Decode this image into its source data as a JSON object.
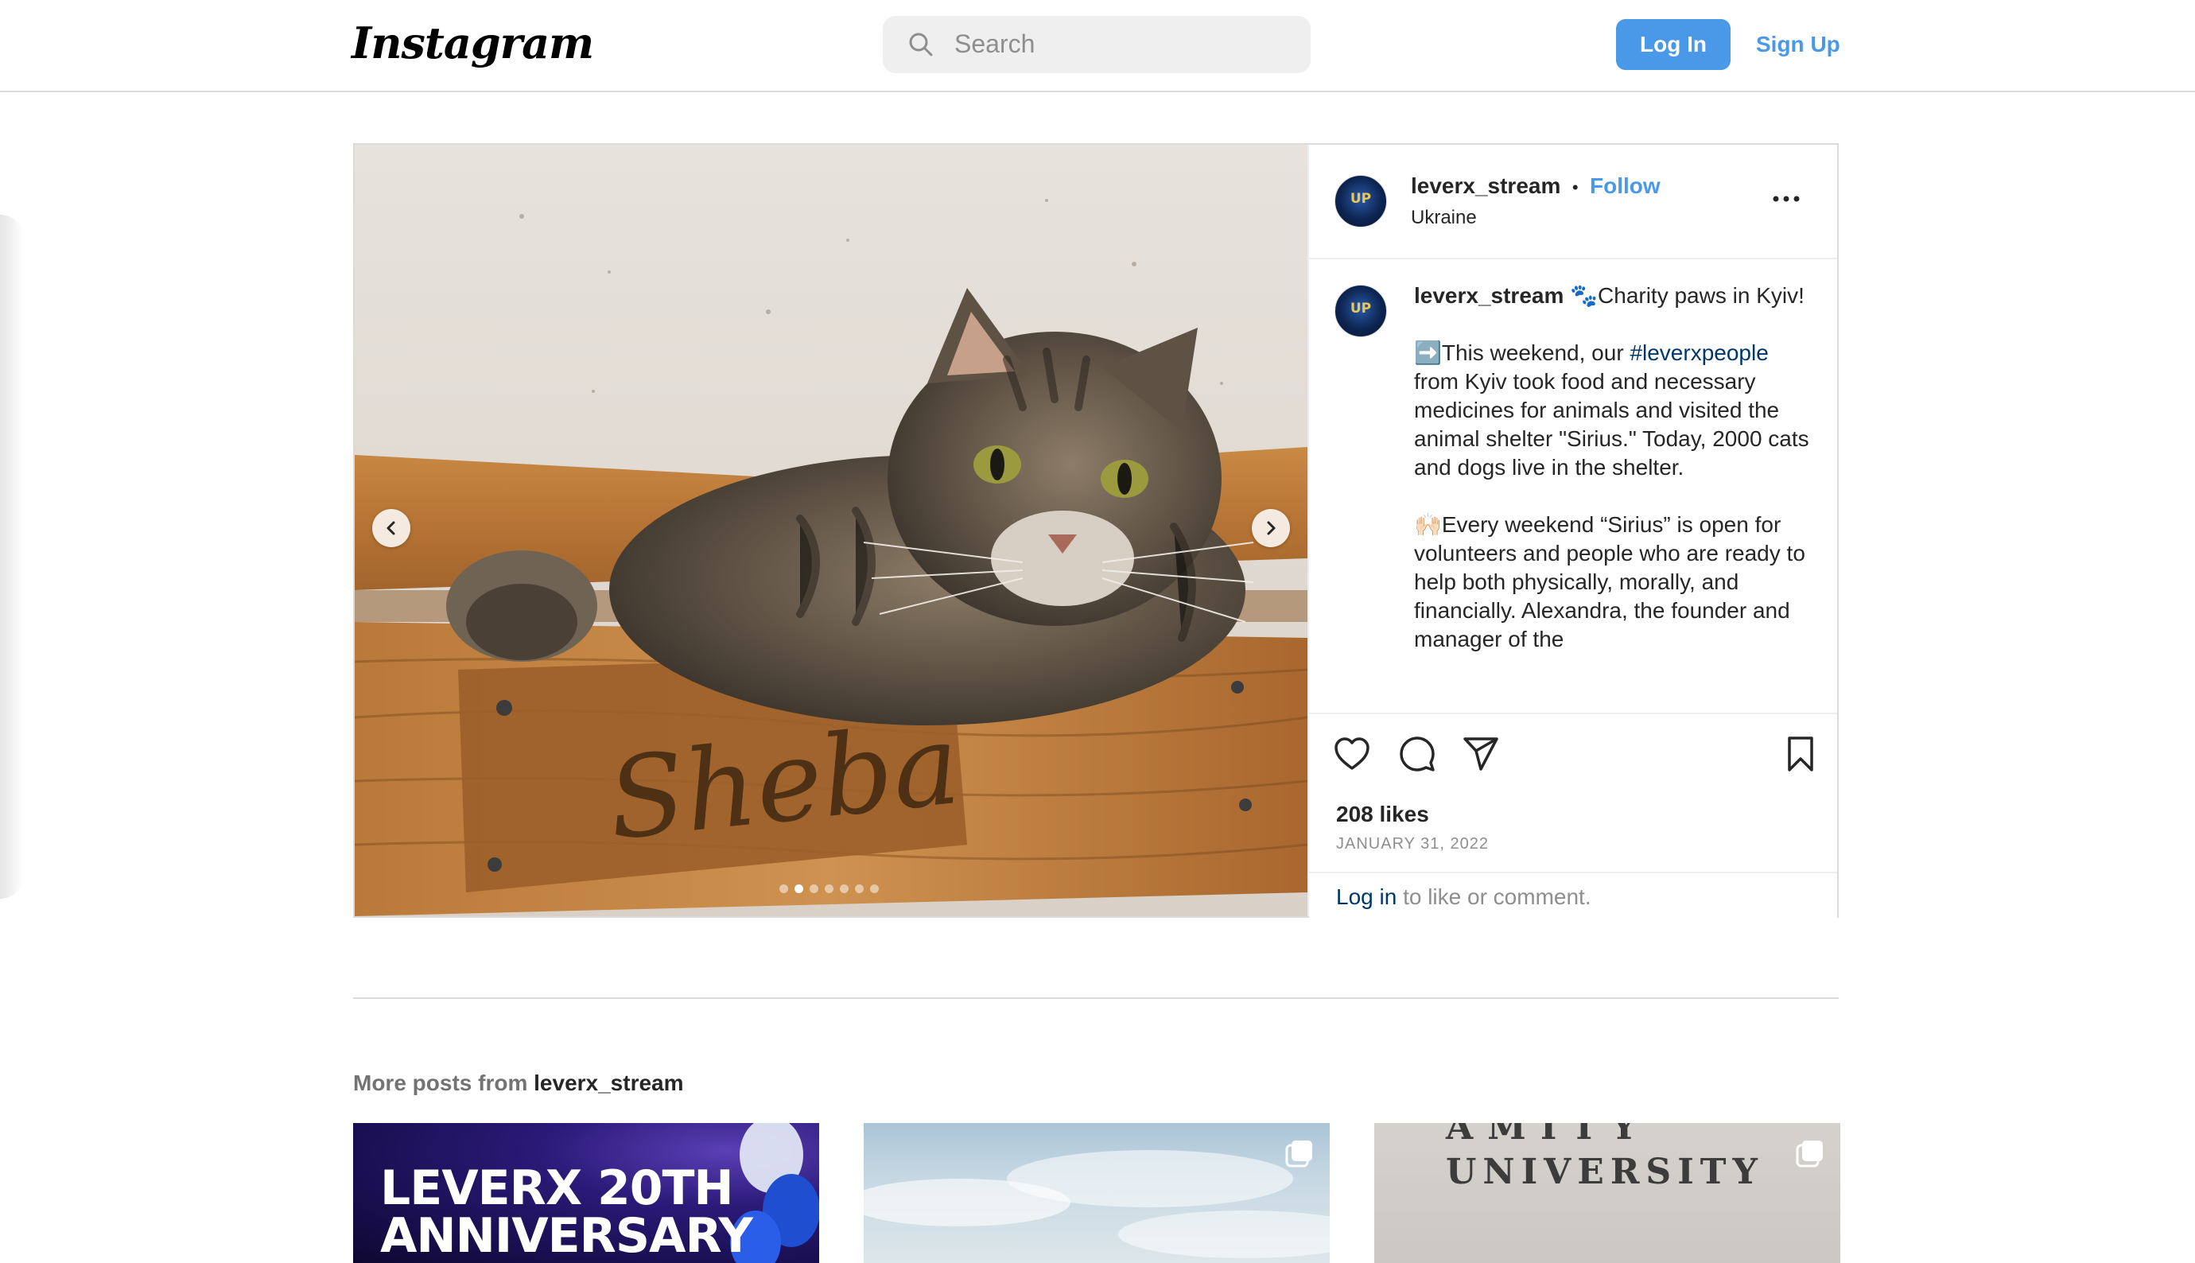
{
  "header": {
    "logo_text": "Instagram",
    "search_placeholder": "Search",
    "login_label": "Log In",
    "signup_label": "Sign Up"
  },
  "post": {
    "username": "leverx_stream",
    "separator": "•",
    "follow_label": "Follow",
    "location": "Ukraine",
    "avatar_text": "UP",
    "more_options_icon": "more-horizontal-icon",
    "caption": {
      "username": "leverx_stream",
      "line1": "🐾Charity paws in Kyiv!",
      "para2_prefix": "➡️This weekend, our ",
      "para2_hashtag": "#leverxpeople",
      "para2_suffix": " from Kyiv took food and necessary medicines for animals and visited the animal shelter \"Sirius.\" Today, 2000 cats and dogs live in the shelter.",
      "para3": "🙌🏻Every weekend “Sirius” is open for volunteers and people who are ready to help both physically, morally, and financially. Alexandra, the founder and manager of the"
    },
    "media": {
      "board_text": "Sheba",
      "carousel_total": 7,
      "carousel_active": 2
    },
    "likes": "208 likes",
    "date": "JANUARY 31, 2022",
    "login_link": "Log in",
    "login_suffix": " to like or comment.",
    "icons": [
      "heart-icon",
      "comment-icon",
      "share-icon",
      "bookmark-icon"
    ]
  },
  "more_posts": {
    "prefix": "More posts from ",
    "username": "leverx_stream",
    "thumbs": [
      {
        "line1": "LEVERX 20TH",
        "line2": "ANNIVERSARY"
      },
      {},
      {
        "top_text": "AMITY",
        "line1": "UNIVERSITY"
      }
    ]
  }
}
